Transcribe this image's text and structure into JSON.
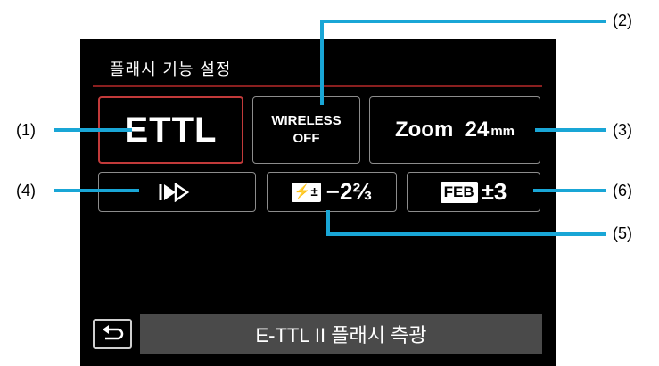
{
  "screen": {
    "title": "플래시 기능 설정",
    "ettl": "ETTL",
    "wireless_line1": "WIRELESS",
    "wireless_line2": "OFF",
    "zoom_label": "Zoom  24",
    "zoom_unit": "mm",
    "sync_mode_icon": "high-speed-sync-icon",
    "sync_mode_glyph": "⯈⯈",
    "fec_badge": "⚡±",
    "fec_value": "−2⅔",
    "feb_badge": "FEB",
    "feb_value": "±3",
    "bottom_label": "E-TTL II 플래시 측광",
    "back_icon": "return-icon"
  },
  "callouts": [
    "(1)",
    "(2)",
    "(3)",
    "(4)",
    "(5)",
    "(6)"
  ],
  "colors": {
    "background": "#000000",
    "selected_border": "#c23a3a",
    "bottom_bar": "#4a4a4a",
    "callout_line": "#19a6d6"
  }
}
